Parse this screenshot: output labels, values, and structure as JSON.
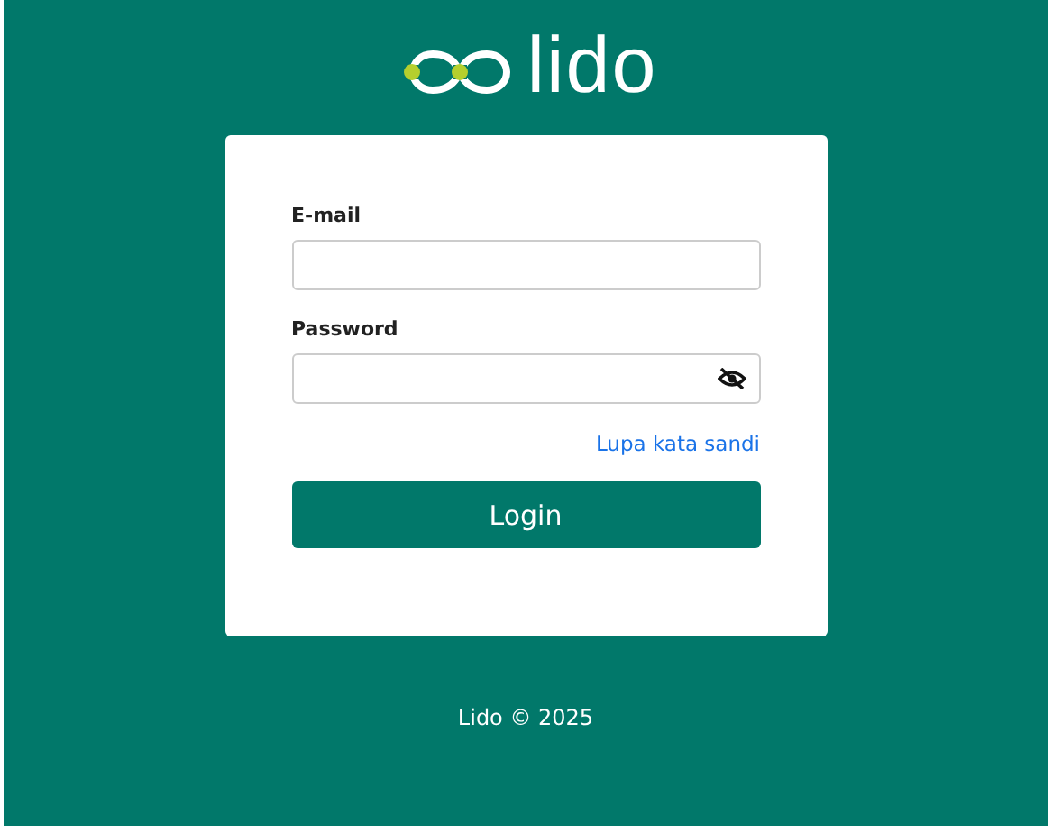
{
  "logo": {
    "text": "lido"
  },
  "form": {
    "fields": [
      {
        "kind": "text",
        "label": "E-mail"
      },
      {
        "kind": "password",
        "label": "Password",
        "visible": false
      }
    ],
    "forgot_link": "Lupa kata sandi",
    "submit": "Login"
  },
  "footer": "Lido © 2025"
}
